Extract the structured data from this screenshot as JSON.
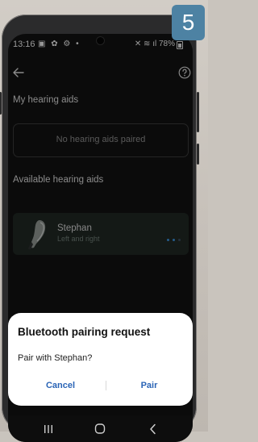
{
  "step_badge": "5",
  "status_bar": {
    "time": "13:16",
    "left_icons": "▣ ✿ ⚙ •",
    "right_info": "✕ ≋ ıl 78%"
  },
  "sections": {
    "my_hearing_aids": "My hearing aids",
    "no_paired": "No hearing aids paired",
    "available": "Available hearing aids"
  },
  "device": {
    "name": "Stephan",
    "sub": "Left and right"
  },
  "dialog": {
    "title": "Bluetooth pairing request",
    "message": "Pair with Stephan?",
    "cancel": "Cancel",
    "pair": "Pair"
  },
  "colors": {
    "accent": "#2a64b6",
    "badge": "#4d82a3",
    "dot_active": "#3a8fd8",
    "dot_inactive": "#3a4c5e"
  }
}
